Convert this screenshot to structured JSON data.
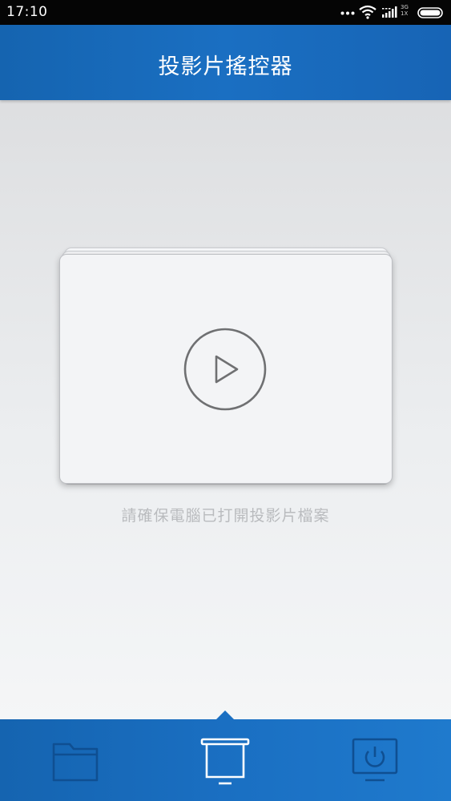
{
  "status_bar": {
    "time": "17:10",
    "network_top": "3G",
    "network_bottom": "1X",
    "icons": [
      "more-dots-icon",
      "wifi-icon",
      "signal-icon",
      "battery-icon"
    ]
  },
  "header": {
    "title": "投影片搖控器"
  },
  "main": {
    "hint": "請確保電腦已打開投影片檔案",
    "play_icon": "play-circle-icon"
  },
  "bottom_nav": {
    "items": [
      {
        "icon": "folder-icon",
        "active": false
      },
      {
        "icon": "projector-screen-icon",
        "active": true
      },
      {
        "icon": "power-monitor-icon",
        "active": false
      }
    ]
  },
  "colors": {
    "accent": "#1a6fc2",
    "icon_inactive": "#0f4f92",
    "icon_active": "#ffffff",
    "hint_text": "#b9bbbe"
  }
}
